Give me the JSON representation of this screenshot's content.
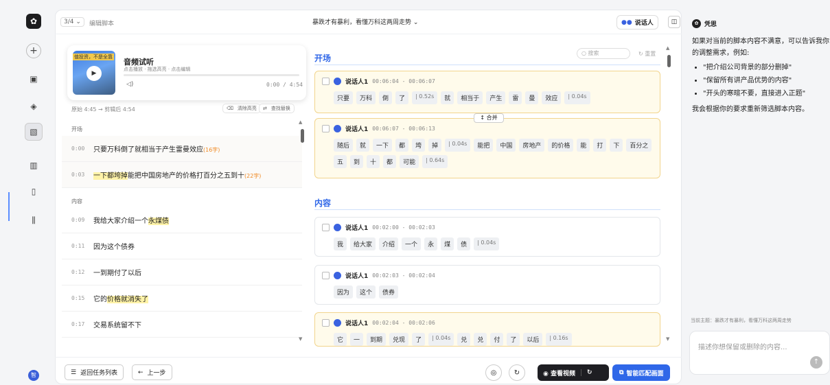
{
  "header": {
    "step_label": "3/4",
    "edit_label": "编辑脚本",
    "title": "暴跌才有暴利，看懂万科这两周走势",
    "speaker_btn": "说话人"
  },
  "audio": {
    "title": "音频试听",
    "subtitle": "点击播放 · 拖选高亮 · 点击编辑",
    "time": "0:00 / 4:54",
    "progress": 0,
    "thumb_text": "值投资，不是全靠",
    "duration_info": "原始 4:45 → 剪辑后 4:54",
    "clear_label": "清除高亮",
    "replace_label": "查找替换"
  },
  "left_script": {
    "sec1": "开场",
    "rows1": [
      {
        "time": "0:00",
        "text": "只要万科倒了就相当于产生雷曼效应",
        "count": "(16字)"
      },
      {
        "time": "0:03",
        "hl": "一下都垮掉",
        "text": "能把中国房地产的价格打百分之五到十",
        "count": "(22字)"
      }
    ],
    "sec2": "内容",
    "rows2": [
      {
        "time": "0:09",
        "text": "我给大家介绍一个",
        "hl": "永煤债"
      },
      {
        "time": "0:11",
        "text": "因为这个债券"
      },
      {
        "time": "0:12",
        "text": "一到期付了以后"
      },
      {
        "time": "0:15",
        "text": "它的",
        "hl": "价格就消失了"
      },
      {
        "time": "0:17",
        "text": "交易系统留不下"
      }
    ]
  },
  "right_script": {
    "search_placeholder": "搜索",
    "reset_label": "重置",
    "merge_label": "合并",
    "sec1": "开场",
    "sec2": "内容",
    "blocks": [
      {
        "speaker": "说话人1",
        "time": "00:06:04 - 00:06:07",
        "tokens": [
          "只要",
          "万科",
          "倒",
          "了",
          "| 0.52s",
          "就",
          "相当于",
          "产生",
          "雷",
          "曼",
          "效应",
          "| 0.04s"
        ]
      },
      {
        "speaker": "说话人1",
        "time": "00:06:07 - 00:06:13",
        "tokens": [
          "随后",
          "就",
          "一下",
          "都",
          "垮",
          "掉",
          "| 0.04s",
          "能把",
          "中国",
          "房地产",
          "的价格",
          "能",
          "打",
          "下",
          "百分之",
          "五",
          "到",
          "十",
          "都",
          "可能",
          "| 0.64s"
        ]
      },
      {
        "speaker": "说话人1",
        "time": "00:02:00 - 00:02:03",
        "tokens": [
          "我",
          "给大家",
          "介绍",
          "一个",
          "永",
          "煤",
          "债",
          "| 0.04s"
        ]
      },
      {
        "speaker": "说话人1",
        "time": "00:02:03 - 00:02:04",
        "tokens": [
          "因为",
          "这个",
          "债券"
        ]
      },
      {
        "speaker": "说话人1",
        "time": "00:02:04 - 00:02:06",
        "tokens": [
          "它",
          "一",
          "到期",
          "兑现",
          "了",
          "| 0.04s",
          "兑",
          "兑",
          "付",
          "了",
          "以后",
          "| 0.16s"
        ]
      }
    ]
  },
  "footer": {
    "back_list": "返回任务列表",
    "prev": "上一步",
    "view_video": "查看视频",
    "smart_match": "智能匹配画面"
  },
  "chat": {
    "bot_name": "凭思",
    "intro": "如果对当前的脚本内容不满意，可以告诉我你的调整需求，例如:",
    "items": [
      "\"把介绍公司背景的部分删掉\"",
      "\"保留所有讲产品优势的内容\"",
      "\"开头的寒暄不要，直接进入正题\""
    ],
    "outro": "我会根据你的要求重新筛选脚本内容。",
    "topic": "当前主题：暴跌才有暴利，看懂万科这两周走势",
    "input_placeholder": "描述你想保留或删除的内容..."
  },
  "rail": {
    "avatar_text": "智"
  }
}
